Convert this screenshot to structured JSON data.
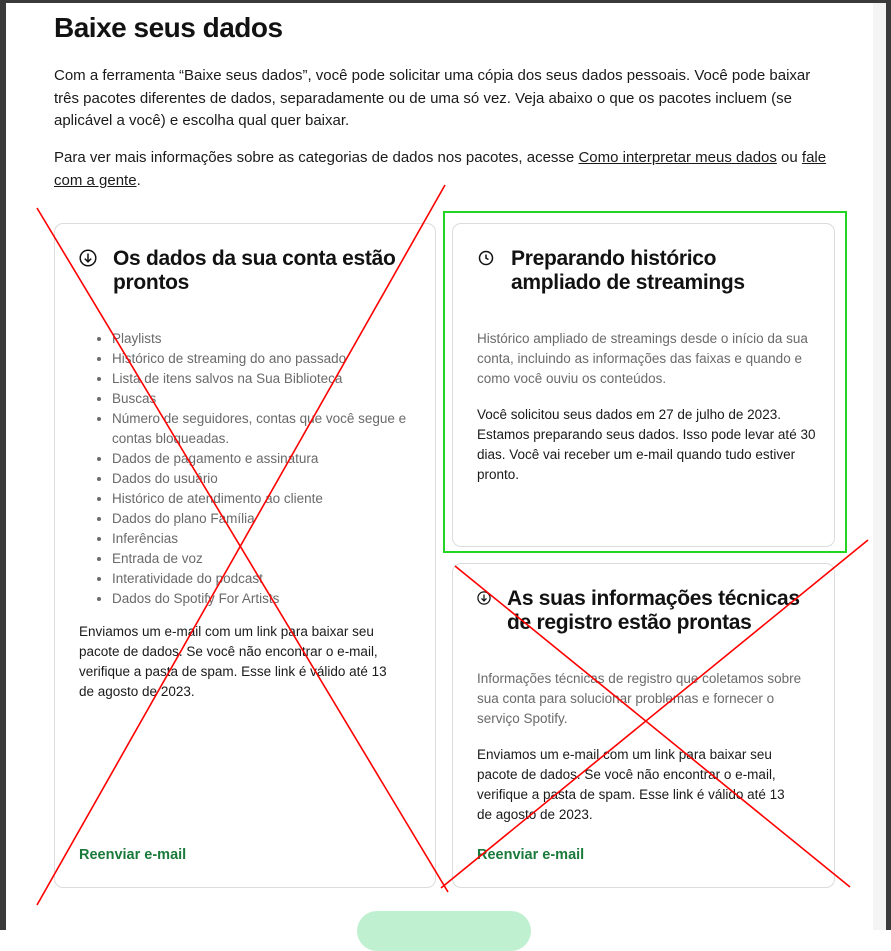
{
  "page": {
    "title": "Baixe seus dados",
    "intro": "Com a ferramenta “Baixe seus dados”, você pode solicitar uma cópia dos seus dados pessoais. Você pode baixar três pacotes diferentes de dados, separadamente ou de uma só vez. Veja abaixo o que os pacotes incluem (se aplicável a você) e escolha qual quer baixar.",
    "info_prefix": "Para ver mais informações sobre as categorias de dados nos pacotes, acesse ",
    "info_link1": "Como interpretar meus dados",
    "info_mid": " ou ",
    "info_link2": "fale com a gente",
    "info_suffix": "."
  },
  "cards": {
    "account": {
      "icon": "download-circle-icon",
      "title": "Os dados da sua conta estão prontos",
      "items": [
        "Playlists",
        "Histórico de streaming do ano passado",
        "Lista de itens salvos na Sua Biblioteca",
        "Buscas",
        "Número de seguidores, contas que você segue e contas bloqueadas.",
        "Dados de pagamento e assinatura",
        "Dados do usuário",
        "Histórico de atendimento ao cliente",
        "Dados do plano Família",
        "Inferências",
        "Entrada de voz",
        "Interatividade do podcast",
        "Dados do Spotify For Artists"
      ],
      "body": "Enviamos um e-mail com um link para baixar seu pacote de dados. Se você não encontrar o e-mail, verifique a pasta de spam. Esse link é válido até 13 de agosto de 2023.",
      "resend": "Reenviar e-mail"
    },
    "streaming": {
      "icon": "clock-icon",
      "title": "Preparando histórico ampliado de streamings",
      "desc": "Histórico ampliado de streamings desde o início da sua conta, incluindo as informações das faixas e quando e como você ouviu os conteúdos.",
      "body": "Você solicitou seus dados em 27 de julho de 2023. Estamos preparando seus dados. Isso pode levar até 30 dias. Você vai receber um e-mail quando tudo estiver pronto."
    },
    "technical": {
      "icon": "download-circle-icon",
      "title": "As suas informações técnicas de registro estão prontas",
      "desc": "Informações técnicas de registro que coletamos sobre sua conta para solucionar problemas e fornecer o serviço Spotify.",
      "body": "Enviamos um e-mail com um link para baixar seu pacote de dados. Se você não encontrar o e-mail, verifique a pasta de spam. Esse link é válido até 13 de agosto de 2023.",
      "resend": "Reenviar e-mail"
    }
  },
  "colors": {
    "accent_green": "#1a7a3a",
    "highlight_box": "#22d522",
    "cross_lines": "#ff0000",
    "button_bg": "#bff0d0"
  }
}
